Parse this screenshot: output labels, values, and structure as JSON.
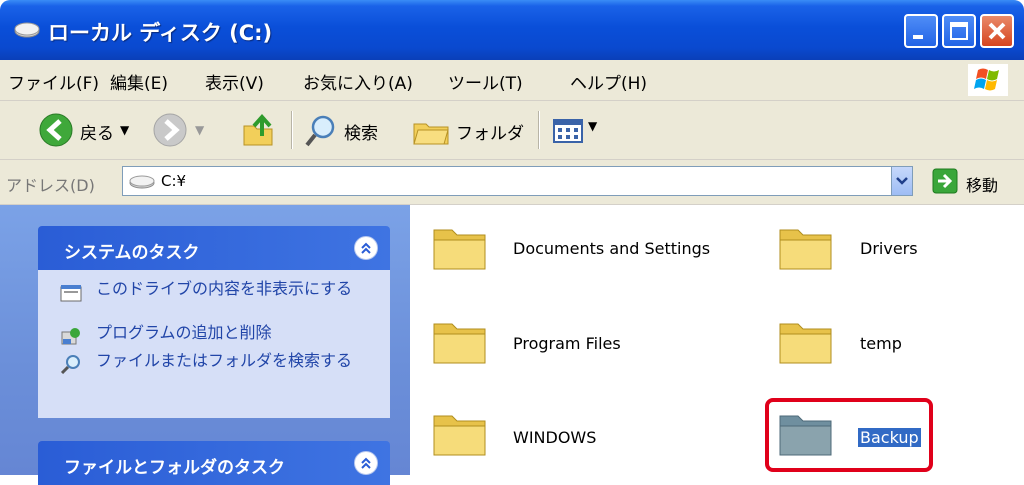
{
  "window": {
    "title": "ローカル ディスク (C:)",
    "buttons": [
      "minimize",
      "maximize",
      "close"
    ]
  },
  "menu": {
    "items": [
      "ファイル(F)",
      "編集(E)",
      "表示(V)",
      "お気に入り(A)",
      "ツール(T)",
      "ヘルプ(H)"
    ]
  },
  "toolbar": {
    "back_label": "戻る",
    "search_label": "検索",
    "folders_label": "フォルダ"
  },
  "address": {
    "label": "アドレス(D)",
    "value": "C:¥",
    "go_label": "移動"
  },
  "tasks": {
    "system_title": "システムのタスク",
    "system_items": [
      "このドライブの内容を非表示にする",
      "プログラムの追加と削除",
      "ファイルまたはフォルダを検索する"
    ],
    "file_title": "ファイルとフォルダのタスク"
  },
  "folders": [
    {
      "name": "Documents and Settings"
    },
    {
      "name": "Drivers"
    },
    {
      "name": "Program Files"
    },
    {
      "name": "temp"
    },
    {
      "name": "WINDOWS"
    },
    {
      "name": "Backup",
      "selected": true
    }
  ],
  "colors": {
    "titlebar": "#0a4fd9",
    "taskpane": "#6b8fd9",
    "selection": "#316ac5",
    "highlight_border": "#e0001a",
    "folder_yellow": "#f6dc7a"
  }
}
